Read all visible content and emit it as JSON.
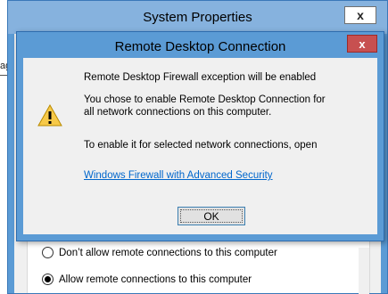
{
  "background_window": {
    "partial_text": "ag"
  },
  "system_properties": {
    "title": "System Properties",
    "close_label": "x",
    "radio_options": [
      {
        "label": "Don’t allow remote connections to this computer",
        "selected": false
      },
      {
        "label": "Allow remote connections to this computer",
        "selected": true
      }
    ]
  },
  "dialog": {
    "title": "Remote Desktop Connection",
    "close_label": "x",
    "icon": "warning-icon",
    "heading": "Remote Desktop Firewall exception will be enabled",
    "message_line1": "You chose to enable Remote Desktop Connection for",
    "message_line2": "all network connections on this computer.",
    "message_line3": "To enable it for selected network connections, open",
    "link_text": "Windows Firewall with Advanced Security",
    "ok_label": "OK"
  },
  "colors": {
    "window_frame": "#5b9bd5",
    "close_red": "#c75050",
    "link_blue": "#0066cc"
  }
}
